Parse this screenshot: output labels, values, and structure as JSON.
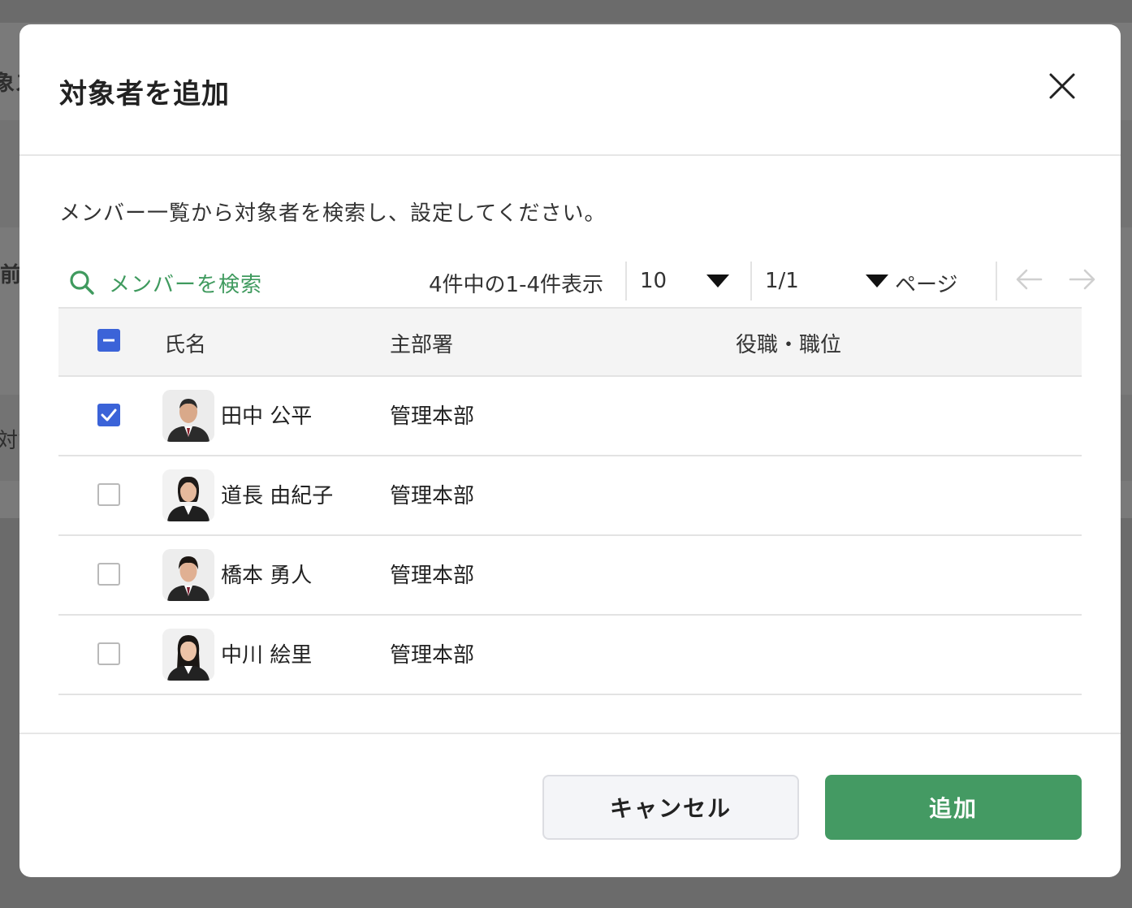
{
  "background": {
    "fragments": [
      "象ス",
      "前",
      "対象"
    ]
  },
  "modal": {
    "title": "対象者を追加",
    "description": "メンバー一覧から対象者を検索し、設定してください。",
    "search_label": "メンバーを検索",
    "count_text": "4件中の1-4件表示",
    "per_page": "10",
    "page": "1/1",
    "page_suffix": "ページ",
    "columns": [
      "氏名",
      "主部署",
      "役職・職位"
    ],
    "rows": [
      {
        "name": "田中 公平",
        "dept": "管理本部",
        "checked": true
      },
      {
        "name": "道長 由紀子",
        "dept": "管理本部",
        "checked": false
      },
      {
        "name": "橋本 勇人",
        "dept": "管理本部",
        "checked": false
      },
      {
        "name": "中川 絵里",
        "dept": "管理本部",
        "checked": false
      }
    ],
    "cancel_label": "キャンセル",
    "add_label": "追加"
  },
  "colors": {
    "accent_green": "#449a63",
    "checkbox_blue": "#3b63d8",
    "overlay": "#6b6b6b"
  }
}
